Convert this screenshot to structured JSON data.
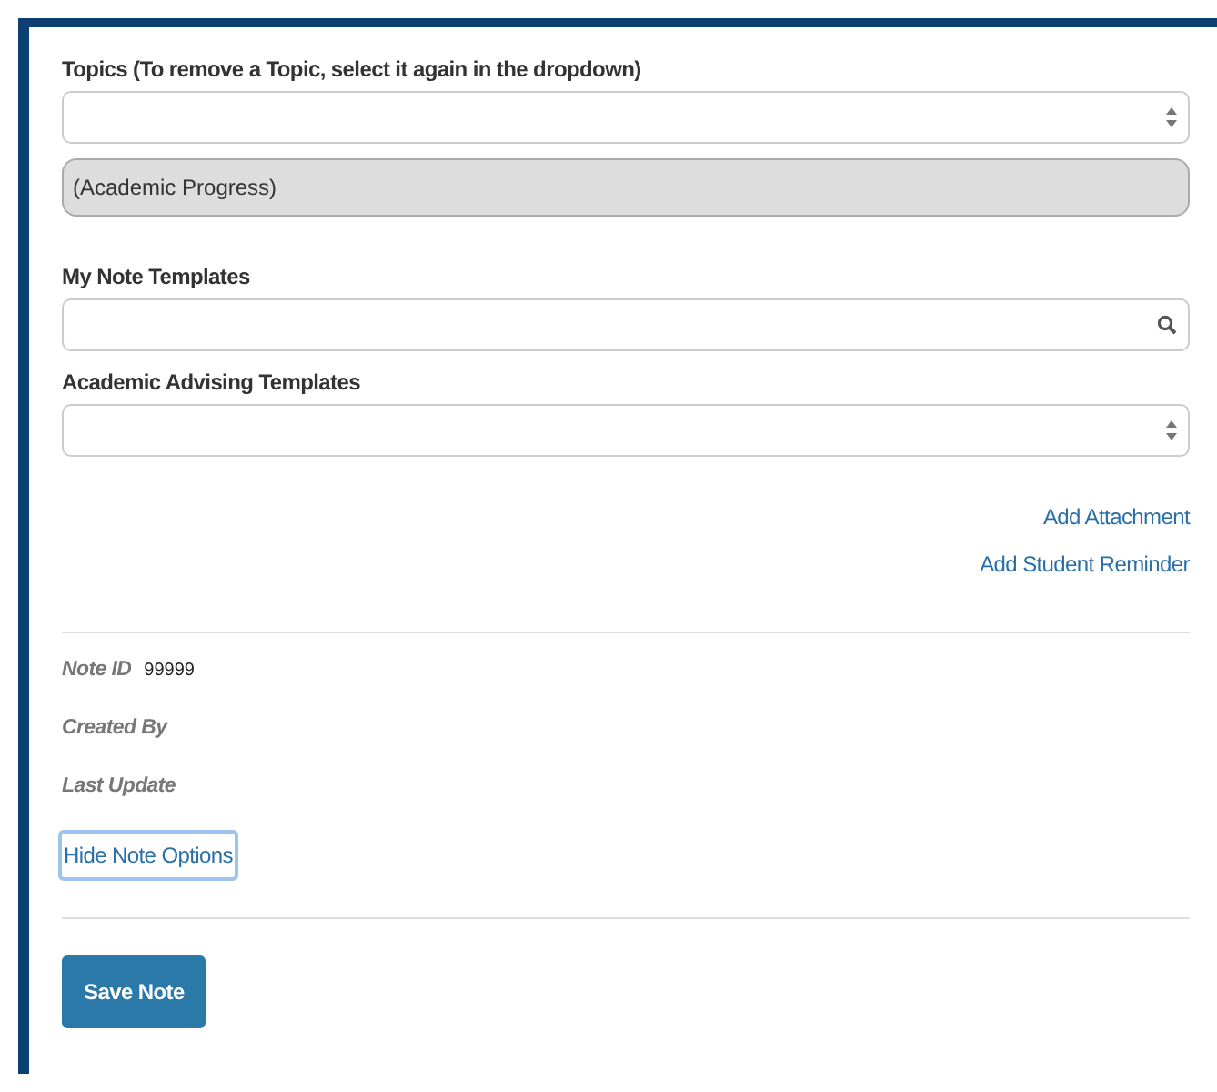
{
  "topics": {
    "label": "Topics (To remove a Topic, select it again in the dropdown)",
    "chips": [
      "(Academic Progress)"
    ]
  },
  "my_note_templates": {
    "label": "My Note Templates"
  },
  "advising_templates": {
    "label": "Academic Advising Templates"
  },
  "links": [
    "Add Attachment",
    "Add Student Reminder"
  ],
  "meta": [
    {
      "label": "Note ID",
      "value": "99999"
    },
    {
      "label": "Created By"
    },
    {
      "label": "Last Update"
    }
  ],
  "options_toggle": {
    "label": "Hide Note Options",
    "focused": true
  },
  "save_button": "Save Note"
}
